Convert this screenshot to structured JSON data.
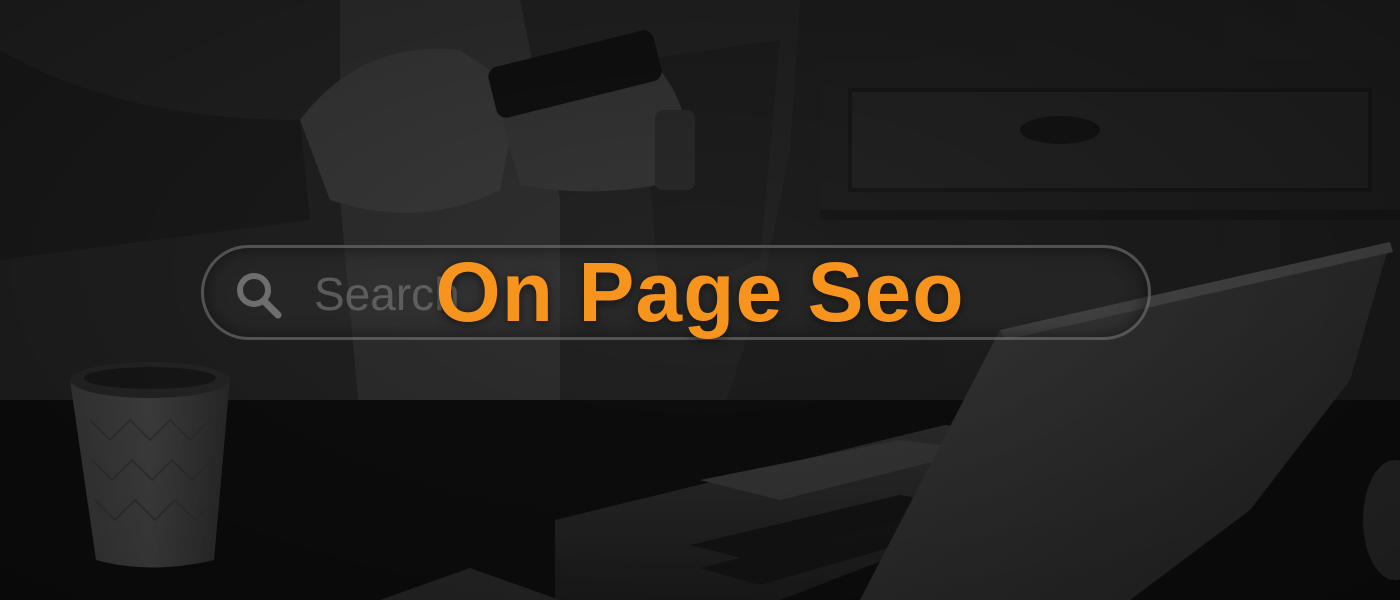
{
  "banner": {
    "headline": "On Page Seo",
    "accent_color": "#f7941d"
  },
  "search_bar": {
    "placeholder": "Search",
    "icon": "search-icon"
  },
  "background": {
    "description_icon": "photo-background",
    "tone": "dark-grayscale"
  }
}
